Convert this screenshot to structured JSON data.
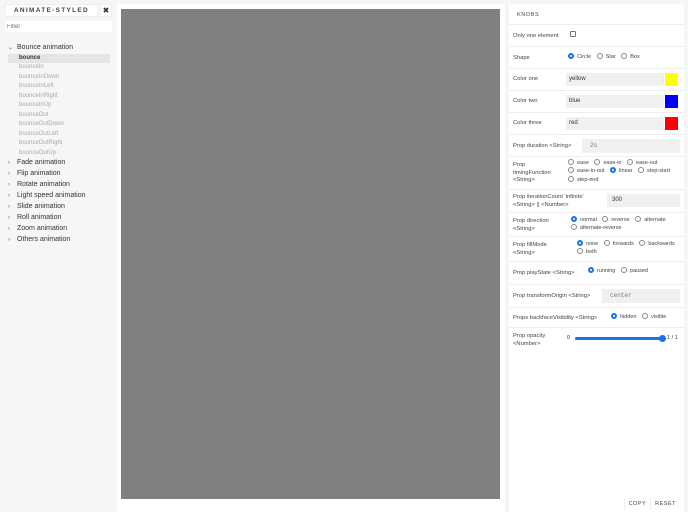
{
  "sidebar": {
    "title": "ANIMATE-STYLED",
    "close_icon": "✖",
    "filter_placeholder": "Filter",
    "groups": [
      {
        "label": "Bounce animation",
        "expanded": true,
        "items": [
          "bounce",
          "bounceIn",
          "bounceInDown",
          "bounceInLeft",
          "bounceInRight",
          "bounceInUp",
          "bounceOut",
          "bounceOutDown",
          "bounceOutLeft",
          "bounceOutRight",
          "bounceOutUp"
        ],
        "selected": "bounce"
      },
      {
        "label": "Fade animation"
      },
      {
        "label": "Flip animation"
      },
      {
        "label": "Rotate animation"
      },
      {
        "label": "Light speed animation"
      },
      {
        "label": "Slide animation"
      },
      {
        "label": "Roll animation"
      },
      {
        "label": "Zoom animation"
      },
      {
        "label": "Others animation"
      }
    ]
  },
  "preview": {
    "background": "#808080",
    "balls": [
      "#ffff00",
      "#0000ff",
      "#ff0000"
    ]
  },
  "knobs": {
    "tab": "KNOBS",
    "only_one": {
      "label": "Only one element",
      "checked": false
    },
    "shape": {
      "label": "Shape",
      "options": [
        "Circle",
        "Star",
        "Box"
      ],
      "selected": "Circle"
    },
    "color_one": {
      "label": "Color one",
      "value": "yellow",
      "swatch": "#ffff00"
    },
    "color_two": {
      "label": "Color two",
      "value": "blue",
      "swatch": "#0000ff"
    },
    "color_three": {
      "label": "Color three",
      "value": "red",
      "swatch": "#ff0000"
    },
    "duration": {
      "label": "Prop duration <String>",
      "value": "2s"
    },
    "timing": {
      "label": "Prop timingFunction <String>",
      "options": [
        "ease",
        "ease-in",
        "ease-out",
        "ease-in-out",
        "linear",
        "step-start",
        "step-end"
      ],
      "selected": "linear"
    },
    "iteration": {
      "label": "Prop iterationCount 'infinite' <String> || <Number>",
      "value": "300"
    },
    "direction": {
      "label": "Prop direction <String>",
      "options": [
        "normal",
        "reverse",
        "alternate",
        "alternate-reverse"
      ],
      "selected": "normal"
    },
    "fillmode": {
      "label": "Prop fillMode <String>",
      "options": [
        "none",
        "forwards",
        "backwards",
        "both"
      ],
      "selected": "none"
    },
    "playstate": {
      "label": "Prop playState <String>",
      "options": [
        "running",
        "paused"
      ],
      "selected": "running"
    },
    "origin": {
      "label": "Prop transformOrigin <String>",
      "value": "center"
    },
    "backface": {
      "label": "Props backfaceVisibility <String>",
      "options": [
        "hidden",
        "visible"
      ],
      "selected": "hidden"
    },
    "opacity": {
      "label": "Prop opacity <Number>",
      "min": "0",
      "value": 1,
      "max_label": "1 / 1"
    },
    "copy": "COPY",
    "reset": "RESET"
  }
}
